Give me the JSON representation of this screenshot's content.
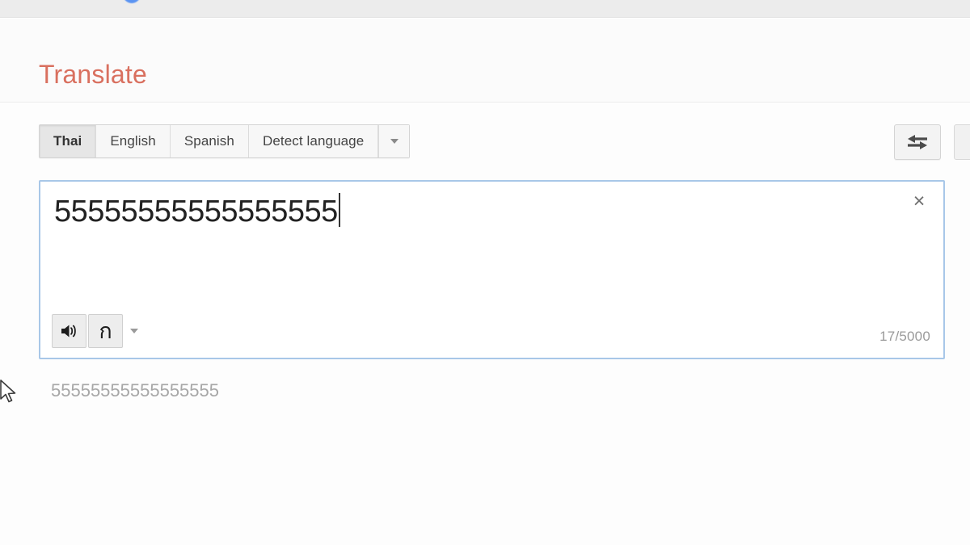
{
  "window": {
    "top_bar_accent_color": "#4285f4"
  },
  "header": {
    "title": "Translate",
    "title_color": "#d9705f"
  },
  "language_bar": {
    "tabs": [
      {
        "label": "Thai",
        "selected": true
      },
      {
        "label": "English",
        "selected": false
      },
      {
        "label": "Spanish",
        "selected": false
      },
      {
        "label": "Detect language",
        "selected": false
      }
    ],
    "more_icon": "chevron-down-icon"
  },
  "controls": {
    "swap_icon": "swap-horizontal-arrows-icon",
    "swap_label": "Swap languages"
  },
  "source": {
    "text": "55555555555555555",
    "clear_icon": "close-icon",
    "clear_label": "×",
    "listen_icon": "speaker-icon",
    "keyboard_icon": "thai-keyboard-icon",
    "keyboard_glyph": "ก",
    "keyboard_caret_icon": "chevron-down-icon",
    "char_count": "17/5000",
    "focus_border_color": "#a8c7e8"
  },
  "result": {
    "text": "55555555555555555",
    "color": "#a7a7a7"
  },
  "pointer": {
    "icon": "mouse-cursor-icon"
  }
}
